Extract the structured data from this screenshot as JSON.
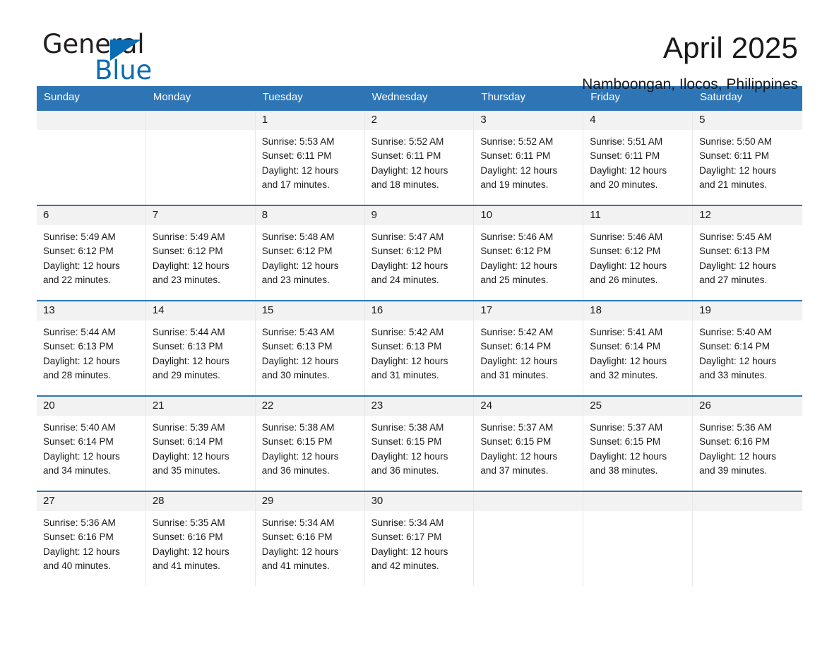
{
  "brand": {
    "name_part1": "General",
    "name_part2": "Blue",
    "triangle_color": "#0a6cb5",
    "accent_color": "#2e75b6"
  },
  "header": {
    "month_title": "April 2025",
    "location": "Namboongan, Ilocos, Philippines"
  },
  "calendar": {
    "weekdays": [
      "Sunday",
      "Monday",
      "Tuesday",
      "Wednesday",
      "Thursday",
      "Friday",
      "Saturday"
    ],
    "weeks": [
      [
        {
          "day": "",
          "sunrise": "",
          "sunset": "",
          "daylight_line1": "",
          "daylight_line2": ""
        },
        {
          "day": "",
          "sunrise": "",
          "sunset": "",
          "daylight_line1": "",
          "daylight_line2": ""
        },
        {
          "day": "1",
          "sunrise": "Sunrise: 5:53 AM",
          "sunset": "Sunset: 6:11 PM",
          "daylight_line1": "Daylight: 12 hours",
          "daylight_line2": "and 17 minutes."
        },
        {
          "day": "2",
          "sunrise": "Sunrise: 5:52 AM",
          "sunset": "Sunset: 6:11 PM",
          "daylight_line1": "Daylight: 12 hours",
          "daylight_line2": "and 18 minutes."
        },
        {
          "day": "3",
          "sunrise": "Sunrise: 5:52 AM",
          "sunset": "Sunset: 6:11 PM",
          "daylight_line1": "Daylight: 12 hours",
          "daylight_line2": "and 19 minutes."
        },
        {
          "day": "4",
          "sunrise": "Sunrise: 5:51 AM",
          "sunset": "Sunset: 6:11 PM",
          "daylight_line1": "Daylight: 12 hours",
          "daylight_line2": "and 20 minutes."
        },
        {
          "day": "5",
          "sunrise": "Sunrise: 5:50 AM",
          "sunset": "Sunset: 6:11 PM",
          "daylight_line1": "Daylight: 12 hours",
          "daylight_line2": "and 21 minutes."
        }
      ],
      [
        {
          "day": "6",
          "sunrise": "Sunrise: 5:49 AM",
          "sunset": "Sunset: 6:12 PM",
          "daylight_line1": "Daylight: 12 hours",
          "daylight_line2": "and 22 minutes."
        },
        {
          "day": "7",
          "sunrise": "Sunrise: 5:49 AM",
          "sunset": "Sunset: 6:12 PM",
          "daylight_line1": "Daylight: 12 hours",
          "daylight_line2": "and 23 minutes."
        },
        {
          "day": "8",
          "sunrise": "Sunrise: 5:48 AM",
          "sunset": "Sunset: 6:12 PM",
          "daylight_line1": "Daylight: 12 hours",
          "daylight_line2": "and 23 minutes."
        },
        {
          "day": "9",
          "sunrise": "Sunrise: 5:47 AM",
          "sunset": "Sunset: 6:12 PM",
          "daylight_line1": "Daylight: 12 hours",
          "daylight_line2": "and 24 minutes."
        },
        {
          "day": "10",
          "sunrise": "Sunrise: 5:46 AM",
          "sunset": "Sunset: 6:12 PM",
          "daylight_line1": "Daylight: 12 hours",
          "daylight_line2": "and 25 minutes."
        },
        {
          "day": "11",
          "sunrise": "Sunrise: 5:46 AM",
          "sunset": "Sunset: 6:12 PM",
          "daylight_line1": "Daylight: 12 hours",
          "daylight_line2": "and 26 minutes."
        },
        {
          "day": "12",
          "sunrise": "Sunrise: 5:45 AM",
          "sunset": "Sunset: 6:13 PM",
          "daylight_line1": "Daylight: 12 hours",
          "daylight_line2": "and 27 minutes."
        }
      ],
      [
        {
          "day": "13",
          "sunrise": "Sunrise: 5:44 AM",
          "sunset": "Sunset: 6:13 PM",
          "daylight_line1": "Daylight: 12 hours",
          "daylight_line2": "and 28 minutes."
        },
        {
          "day": "14",
          "sunrise": "Sunrise: 5:44 AM",
          "sunset": "Sunset: 6:13 PM",
          "daylight_line1": "Daylight: 12 hours",
          "daylight_line2": "and 29 minutes."
        },
        {
          "day": "15",
          "sunrise": "Sunrise: 5:43 AM",
          "sunset": "Sunset: 6:13 PM",
          "daylight_line1": "Daylight: 12 hours",
          "daylight_line2": "and 30 minutes."
        },
        {
          "day": "16",
          "sunrise": "Sunrise: 5:42 AM",
          "sunset": "Sunset: 6:13 PM",
          "daylight_line1": "Daylight: 12 hours",
          "daylight_line2": "and 31 minutes."
        },
        {
          "day": "17",
          "sunrise": "Sunrise: 5:42 AM",
          "sunset": "Sunset: 6:14 PM",
          "daylight_line1": "Daylight: 12 hours",
          "daylight_line2": "and 31 minutes."
        },
        {
          "day": "18",
          "sunrise": "Sunrise: 5:41 AM",
          "sunset": "Sunset: 6:14 PM",
          "daylight_line1": "Daylight: 12 hours",
          "daylight_line2": "and 32 minutes."
        },
        {
          "day": "19",
          "sunrise": "Sunrise: 5:40 AM",
          "sunset": "Sunset: 6:14 PM",
          "daylight_line1": "Daylight: 12 hours",
          "daylight_line2": "and 33 minutes."
        }
      ],
      [
        {
          "day": "20",
          "sunrise": "Sunrise: 5:40 AM",
          "sunset": "Sunset: 6:14 PM",
          "daylight_line1": "Daylight: 12 hours",
          "daylight_line2": "and 34 minutes."
        },
        {
          "day": "21",
          "sunrise": "Sunrise: 5:39 AM",
          "sunset": "Sunset: 6:14 PM",
          "daylight_line1": "Daylight: 12 hours",
          "daylight_line2": "and 35 minutes."
        },
        {
          "day": "22",
          "sunrise": "Sunrise: 5:38 AM",
          "sunset": "Sunset: 6:15 PM",
          "daylight_line1": "Daylight: 12 hours",
          "daylight_line2": "and 36 minutes."
        },
        {
          "day": "23",
          "sunrise": "Sunrise: 5:38 AM",
          "sunset": "Sunset: 6:15 PM",
          "daylight_line1": "Daylight: 12 hours",
          "daylight_line2": "and 36 minutes."
        },
        {
          "day": "24",
          "sunrise": "Sunrise: 5:37 AM",
          "sunset": "Sunset: 6:15 PM",
          "daylight_line1": "Daylight: 12 hours",
          "daylight_line2": "and 37 minutes."
        },
        {
          "day": "25",
          "sunrise": "Sunrise: 5:37 AM",
          "sunset": "Sunset: 6:15 PM",
          "daylight_line1": "Daylight: 12 hours",
          "daylight_line2": "and 38 minutes."
        },
        {
          "day": "26",
          "sunrise": "Sunrise: 5:36 AM",
          "sunset": "Sunset: 6:16 PM",
          "daylight_line1": "Daylight: 12 hours",
          "daylight_line2": "and 39 minutes."
        }
      ],
      [
        {
          "day": "27",
          "sunrise": "Sunrise: 5:36 AM",
          "sunset": "Sunset: 6:16 PM",
          "daylight_line1": "Daylight: 12 hours",
          "daylight_line2": "and 40 minutes."
        },
        {
          "day": "28",
          "sunrise": "Sunrise: 5:35 AM",
          "sunset": "Sunset: 6:16 PM",
          "daylight_line1": "Daylight: 12 hours",
          "daylight_line2": "and 41 minutes."
        },
        {
          "day": "29",
          "sunrise": "Sunrise: 5:34 AM",
          "sunset": "Sunset: 6:16 PM",
          "daylight_line1": "Daylight: 12 hours",
          "daylight_line2": "and 41 minutes."
        },
        {
          "day": "30",
          "sunrise": "Sunrise: 5:34 AM",
          "sunset": "Sunset: 6:17 PM",
          "daylight_line1": "Daylight: 12 hours",
          "daylight_line2": "and 42 minutes."
        },
        {
          "day": "",
          "sunrise": "",
          "sunset": "",
          "daylight_line1": "",
          "daylight_line2": ""
        },
        {
          "day": "",
          "sunrise": "",
          "sunset": "",
          "daylight_line1": "",
          "daylight_line2": ""
        },
        {
          "day": "",
          "sunrise": "",
          "sunset": "",
          "daylight_line1": "",
          "daylight_line2": ""
        }
      ]
    ]
  }
}
